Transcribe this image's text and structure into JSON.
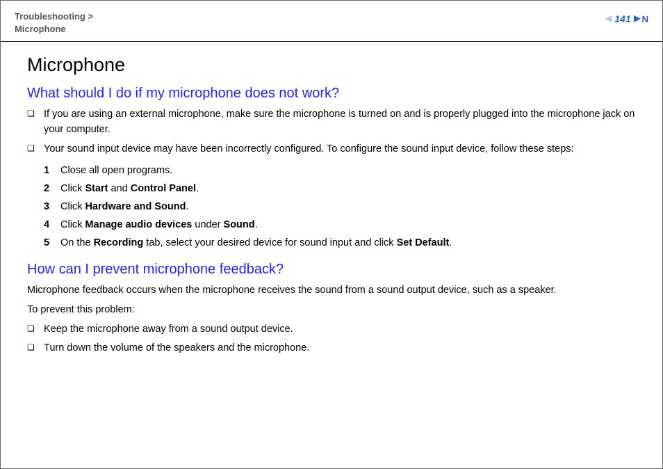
{
  "header": {
    "breadcrumb_parent": "Troubleshooting",
    "breadcrumb_sep": " > ",
    "breadcrumb_current": "Microphone",
    "page_number": "141",
    "nav_letter": "N"
  },
  "title": "Microphone",
  "section1": {
    "heading": "What should I do if my microphone does not work?",
    "bullets": [
      "If you are using an external microphone, make sure the microphone is turned on and is properly plugged into the microphone jack on your computer.",
      "Your sound input device may have been incorrectly configured. To configure the sound input device, follow these steps:"
    ],
    "steps": [
      {
        "n": "1",
        "pre": "Close all open programs."
      },
      {
        "n": "2",
        "pre": "Click ",
        "b1": "Start",
        "mid": " and ",
        "b2": "Control Panel",
        "post": "."
      },
      {
        "n": "3",
        "pre": "Click ",
        "b1": "Hardware and Sound",
        "post": "."
      },
      {
        "n": "4",
        "pre": "Click ",
        "b1": "Manage audio devices",
        "mid": " under ",
        "b2": "Sound",
        "post": "."
      },
      {
        "n": "5",
        "pre": "On the ",
        "b1": "Recording",
        "mid": " tab, select your desired device for sound input and click ",
        "b2": "Set Default",
        "post": "."
      }
    ]
  },
  "section2": {
    "heading": "How can I prevent microphone feedback?",
    "intro1": "Microphone feedback occurs when the microphone receives the sound from a sound output device, such as a speaker.",
    "intro2": "To prevent this problem:",
    "bullets": [
      "Keep the microphone away from a sound output device.",
      "Turn down the volume of the speakers and the microphone."
    ]
  }
}
